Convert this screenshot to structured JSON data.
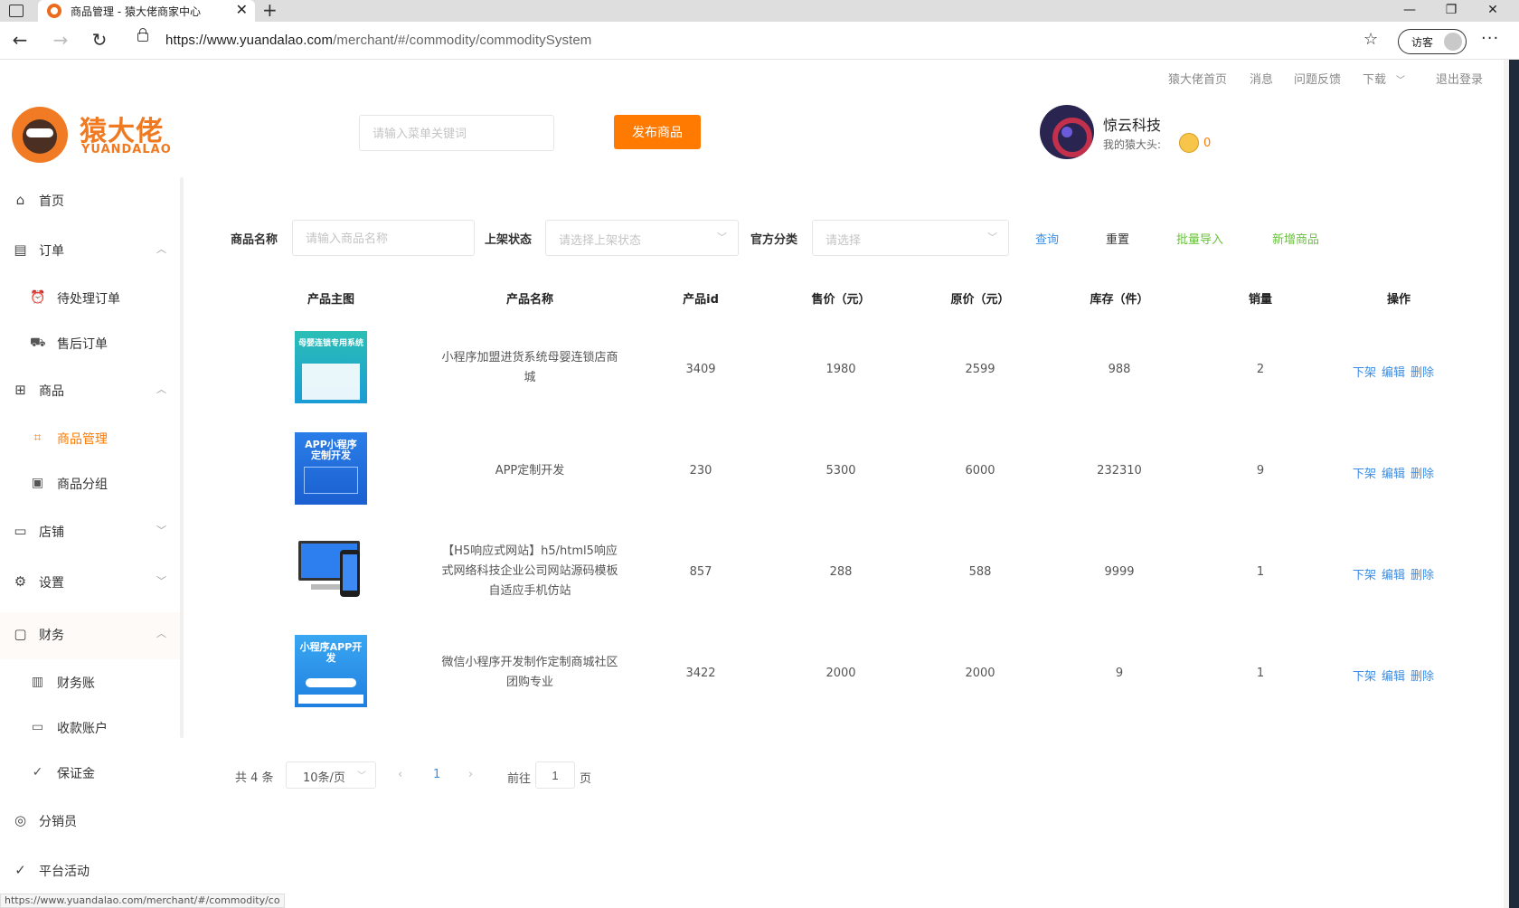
{
  "browser": {
    "tab_title": "商品管理 - 猿大佬商家中心",
    "url_main": "https://www.yuandalao.com",
    "url_path": "/merchant/#/commodity/commoditySystem",
    "guest_label": "访客",
    "status_url": "https://www.yuandalao.com/merchant/#/commodity/co"
  },
  "toplinks": [
    "猿大佬首页",
    "消息",
    "问题反馈",
    "下载",
    "退出登录"
  ],
  "logo": {
    "cn": "猿大佬",
    "en": "YUANDALAO"
  },
  "header": {
    "search_placeholder": "请输入菜单关键词",
    "publish_label": "发布商品",
    "shop_name": "惊云科技",
    "coin_label": "我的猿大头:",
    "coin_count": "0"
  },
  "sidebar": {
    "home": "首页",
    "orders": "订单",
    "pending_orders": "待处理订单",
    "after_sale": "售后订单",
    "goods": "商品",
    "goods_manage": "商品管理",
    "goods_group": "商品分组",
    "store": "店铺",
    "settings": "设置",
    "finance": "财务",
    "finance_bill": "财务账",
    "receive_account": "收款账户",
    "deposit": "保证金",
    "distributor": "分销员",
    "activity": "平台活动"
  },
  "filters": {
    "name_label": "商品名称",
    "name_placeholder": "请输入商品名称",
    "status_label": "上架状态",
    "status_placeholder": "请选择上架状态",
    "category_label": "官方分类",
    "category_placeholder": "请选择",
    "query": "查询",
    "reset": "重置",
    "batch_import": "批量导入",
    "add_goods": "新增商品"
  },
  "table": {
    "headers": [
      "产品主图",
      "产品名称",
      "产品id",
      "售价（元）",
      "原价（元）",
      "库存（件）",
      "销量",
      "操作"
    ],
    "rows": [
      {
        "thumb_text": "母婴连锁专用系统",
        "name": "小程序加盟进货系统母婴连锁店商城",
        "id": "3409",
        "price": "1980",
        "orig": "2599",
        "stock": "988",
        "sales": "2"
      },
      {
        "thumb_text": "APP小程序 定制开发",
        "name": "APP定制开发",
        "id": "230",
        "price": "5300",
        "orig": "6000",
        "stock": "232310",
        "sales": "9"
      },
      {
        "thumb_text": "",
        "name": "【H5响应式网站】h5/html5响应式网络科技企业公司网站源码模板自适应手机仿站",
        "id": "857",
        "price": "288",
        "orig": "588",
        "stock": "9999",
        "sales": "1"
      },
      {
        "thumb_text": "小程序APP开发",
        "name": "微信小程序开发制作定制商城社区团购专业",
        "id": "3422",
        "price": "2000",
        "orig": "2000",
        "stock": "9",
        "sales": "1"
      }
    ],
    "ops": [
      "下架",
      "编辑",
      "删除"
    ]
  },
  "pagination": {
    "total": "共 4 条",
    "page_size": "10条/页",
    "current": "1",
    "goto": "前往",
    "goto_value": "1",
    "page_suffix": "页"
  },
  "colors": {
    "accent": "#ff7a00",
    "link": "#3a8ee6",
    "green": "#67c23a"
  }
}
